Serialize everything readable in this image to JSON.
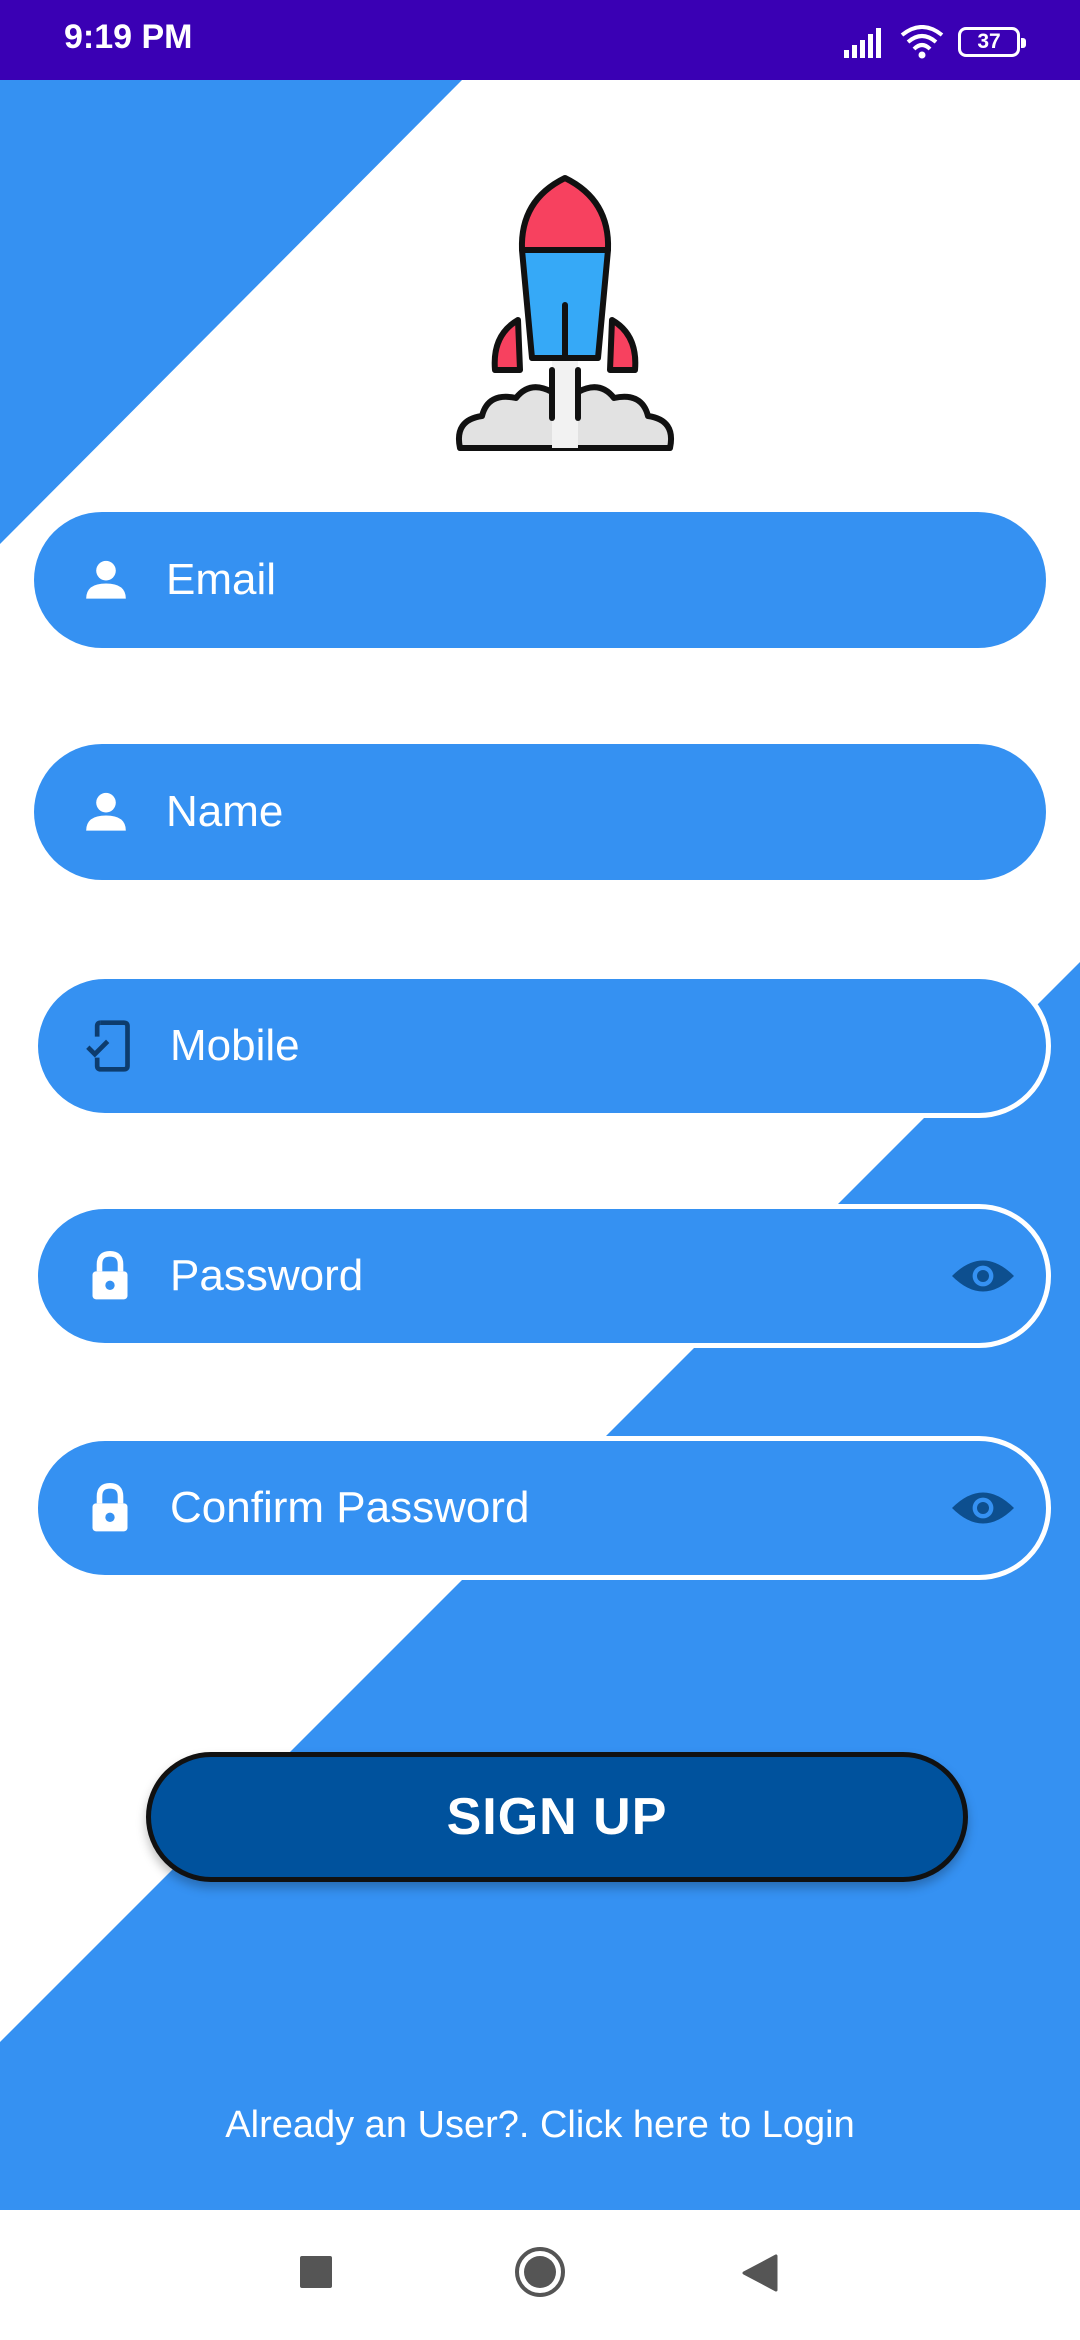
{
  "status_bar": {
    "time": "9:19 PM",
    "battery": "37",
    "icons": [
      "signal-icon",
      "wifi-icon",
      "battery-icon"
    ]
  },
  "logo": {
    "name": "rocket-logo"
  },
  "form": {
    "email": {
      "placeholder": "Email",
      "icon": "person-icon"
    },
    "name": {
      "placeholder": "Name",
      "icon": "person-icon"
    },
    "mobile": {
      "placeholder": "Mobile",
      "icon": "phone-check-icon"
    },
    "password": {
      "placeholder": "Password",
      "icon": "lock-icon",
      "toggle_icon": "eye-icon"
    },
    "confirm_password": {
      "placeholder": "Confirm Password",
      "icon": "lock-icon",
      "toggle_icon": "eye-icon"
    }
  },
  "signup_button": {
    "label": "SIGN UP"
  },
  "login_link": {
    "text": "Already an User?. Click here to Login"
  },
  "nav_bar": {
    "icons": [
      "recents-square-icon",
      "home-circle-icon",
      "back-triangle-icon"
    ]
  },
  "colors": {
    "status_bar": "#3a00b4",
    "accent": "#3591f2",
    "button": "#00529d",
    "eye_icon": "#0d4f8f"
  }
}
